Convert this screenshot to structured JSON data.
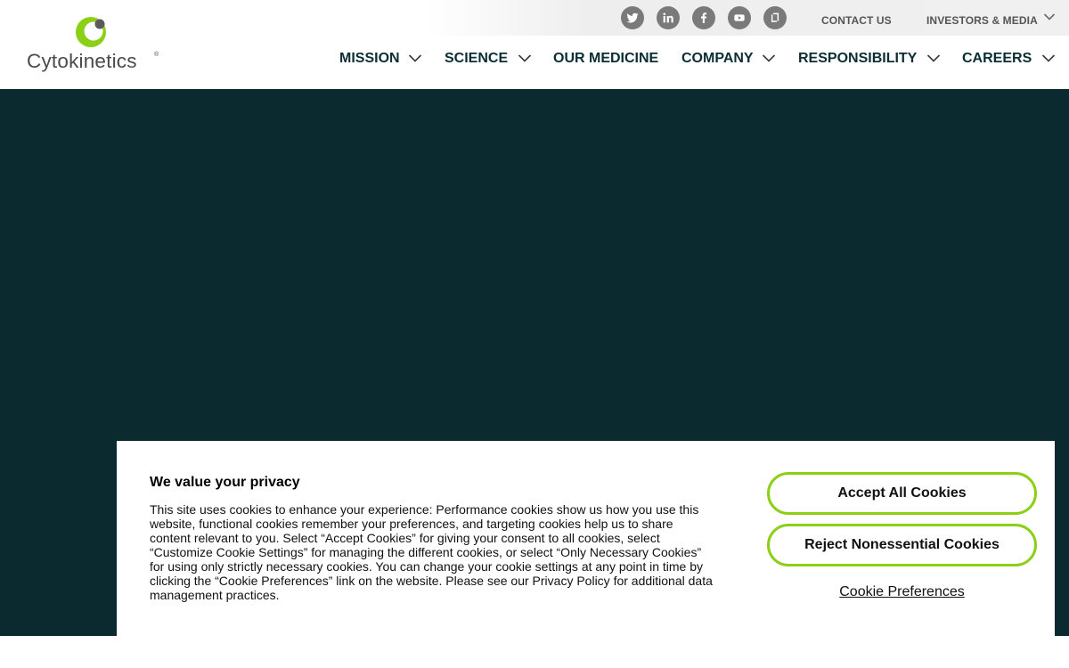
{
  "brand": {
    "name": "Cytokinetics",
    "registered_mark": "®",
    "colors": {
      "green": "#8ccf17",
      "dark": "#0a2a2f",
      "gray": "#5a5a5a"
    }
  },
  "utility": {
    "social_icons": [
      "twitter-icon",
      "linkedin-icon",
      "facebook-icon",
      "youtube-icon",
      "glassdoor-icon"
    ],
    "contact_label": "CONTACT US",
    "investors_label": "INVESTORS & MEDIA"
  },
  "nav": {
    "items": [
      {
        "label": "MISSION",
        "dropdown": true
      },
      {
        "label": "SCIENCE",
        "dropdown": true
      },
      {
        "label": "OUR MEDICINE",
        "dropdown": false
      },
      {
        "label": "COMPANY",
        "dropdown": true
      },
      {
        "label": "RESPONSIBILITY",
        "dropdown": true
      },
      {
        "label": "CAREERS",
        "dropdown": true
      }
    ]
  },
  "cookie": {
    "title": "We value your privacy",
    "body": "This site uses cookies to enhance your experience: Performance cookies show us how you use this website, functional cookies remember your preferences, and targeting cookies help us to share content relevant to you. Select “Accept Cookies” for giving your consent to all cookies, select “Customize Cookie Settings” for managing the different cookies, or select “Only Necessary Cookies” for using only strictly necessary cookies. You can change your cookie settings at any point in time by clicking the “Cookie Preferences” link on the website. Please see our Privacy Policy for additional data management practices.",
    "accept_label": "Accept All Cookies",
    "reject_label": "Reject Nonessential Cookies",
    "preferences_label": "Cookie Preferences"
  }
}
